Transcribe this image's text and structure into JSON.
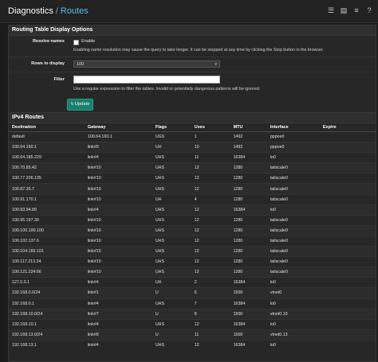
{
  "breadcrumb": {
    "section": "Diagnostics",
    "separator": "/",
    "page": "Routes"
  },
  "header_icons": [
    "sliders-icon",
    "chart-icon",
    "list-icon",
    "help-icon"
  ],
  "options_panel": {
    "title": "Routing Table Display Options",
    "resolve_names": {
      "label": "Resolve names",
      "checkbox_label": "Enable",
      "checked": false,
      "help": "Enabling name resolution may cause the query to take longer. It can be stopped at any time by clicking the Stop button in the browser."
    },
    "rows_to_display": {
      "label": "Rows to display",
      "value": "100"
    },
    "filter": {
      "label": "Filter",
      "value": "",
      "help": "Use a regular expression to filter the tables. Invalid or potentially dangerous patterns will be ignored."
    },
    "update_button": "Update"
  },
  "routes": {
    "title": "IPv4 Routes",
    "columns": [
      "Destination",
      "Gateway",
      "Flags",
      "Uses",
      "MTU",
      "Interface",
      "Expire"
    ],
    "rows": [
      [
        "default",
        "100.64.160.1",
        "UGS",
        "1",
        "1492",
        "pppoe0",
        ""
      ],
      [
        "100.64.160.1",
        "link#9",
        "UH",
        "10",
        "1492",
        "pppoe0",
        ""
      ],
      [
        "100.64.185.229",
        "link#4",
        "UHS",
        "11",
        "16384",
        "lo0",
        ""
      ],
      [
        "100.70.85.42",
        "link#10",
        "UHS",
        "12",
        "1280",
        "tailscale0",
        ""
      ],
      [
        "100.77.206.135",
        "link#10",
        "UHS",
        "12",
        "1280",
        "tailscale0",
        ""
      ],
      [
        "100.87.35.7",
        "link#10",
        "UHS",
        "12",
        "1280",
        "tailscale0",
        ""
      ],
      [
        "100.91.170.1",
        "link#10",
        "UH",
        "4",
        "1280",
        "tailscale0",
        ""
      ],
      [
        "100.93.94.89",
        "link#4",
        "UHS",
        "12",
        "16384",
        "lo0",
        ""
      ],
      [
        "100.95.197.39",
        "link#10",
        "UHS",
        "12",
        "1280",
        "tailscale0",
        ""
      ],
      [
        "100.100.100.100",
        "link#10",
        "UHS",
        "12",
        "1280",
        "tailscale0",
        ""
      ],
      [
        "100.102.137.6",
        "link#10",
        "UHS",
        "12",
        "1280",
        "tailscale0",
        ""
      ],
      [
        "100.104.165.101",
        "link#10",
        "UHS",
        "12",
        "1280",
        "tailscale0",
        ""
      ],
      [
        "100.117.213.34",
        "link#10",
        "UHS",
        "12",
        "1280",
        "tailscale0",
        ""
      ],
      [
        "100.121.224.66",
        "link#10",
        "UHS",
        "12",
        "1280",
        "tailscale0",
        ""
      ],
      [
        "127.0.0.1",
        "link#4",
        "UH",
        "2",
        "16384",
        "lo0",
        ""
      ],
      [
        "192.168.0.0/24",
        "link#1",
        "U",
        "6",
        "1500",
        "vtnet0",
        ""
      ],
      [
        "192.168.0.1",
        "link#4",
        "UHS",
        "7",
        "16384",
        "lo0",
        ""
      ],
      [
        "192.168.10.0/24",
        "link#7",
        "U",
        "8",
        "1500",
        "vtnet0.10",
        ""
      ],
      [
        "192.168.10.1",
        "link#4",
        "UHS",
        "12",
        "16384",
        "lo0",
        ""
      ],
      [
        "192.168.13.0/24",
        "link#8",
        "U",
        "11",
        "1500",
        "vtnet0.13",
        ""
      ],
      [
        "192.168.13.1",
        "link#4",
        "UHS",
        "12",
        "16384",
        "lo0",
        ""
      ]
    ]
  }
}
